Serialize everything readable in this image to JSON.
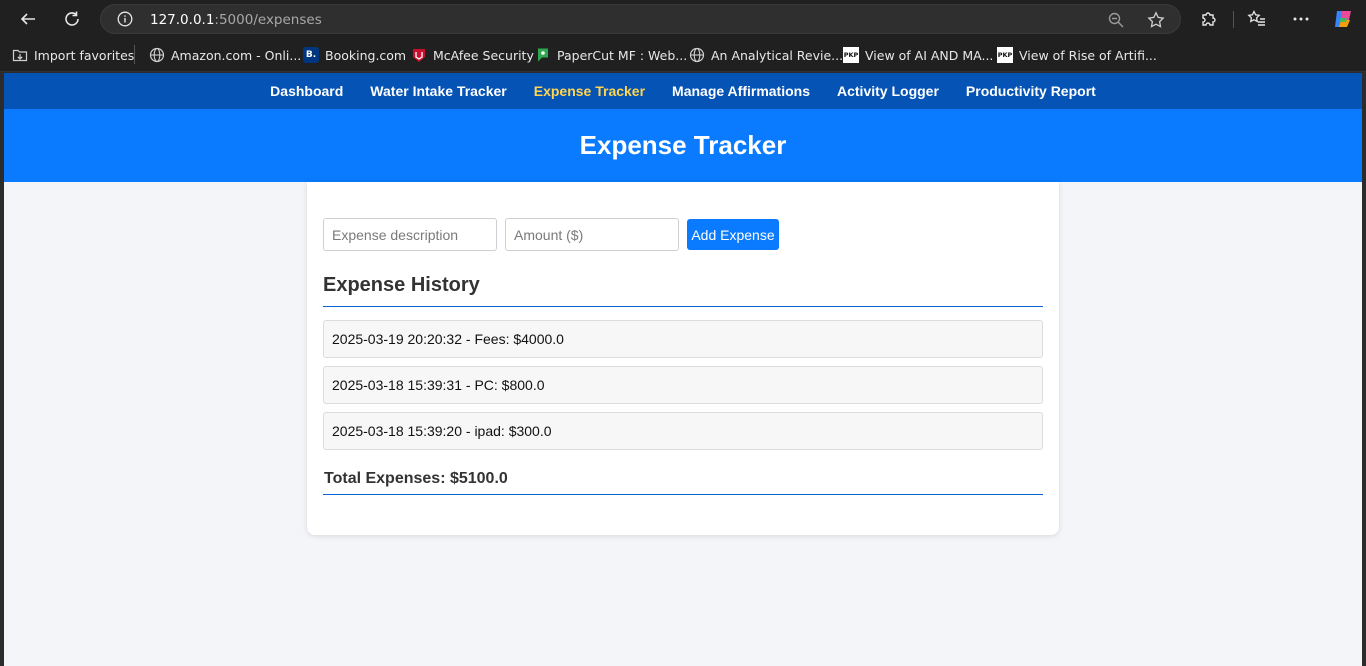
{
  "browser": {
    "url_host": "127.0.0.1",
    "url_rest": ":5000/expenses",
    "bookmarks": [
      {
        "label": "Import favorites",
        "icon": "folder-import-icon"
      },
      {
        "label": "Amazon.com - Onli...",
        "icon": "globe-icon"
      },
      {
        "label": "Booking.com",
        "icon": "booking-icon"
      },
      {
        "label": "McAfee Security",
        "icon": "mcafee-icon"
      },
      {
        "label": "PaperCut MF : Web...",
        "icon": "papercut-icon"
      },
      {
        "label": "An Analytical Revie...",
        "icon": "globe-icon"
      },
      {
        "label": "View of AI AND MA...",
        "icon": "pkp-icon"
      },
      {
        "label": "View of Rise of Artifi...",
        "icon": "pkp-icon"
      }
    ],
    "booking_glyph": "B.",
    "pkp_glyph": "PKP"
  },
  "nav": {
    "items": [
      "Dashboard",
      "Water Intake Tracker",
      "Expense Tracker",
      "Manage Affirmations",
      "Activity Logger",
      "Productivity Report"
    ],
    "active": "Expense Tracker",
    "active_color": "#ffd54f",
    "bg_color": "#0553b5"
  },
  "header": {
    "title": "Expense Tracker",
    "bg_color": "#0a7bfe"
  },
  "form": {
    "description_placeholder": "Expense description",
    "description_value": "",
    "amount_placeholder": "Amount ($)",
    "amount_value": "",
    "add_label": "Add Expense"
  },
  "history": {
    "title": "Expense History",
    "entries": [
      "2025-03-19 20:20:32 - Fees: $4000.0",
      "2025-03-18 15:39:31 - PC: $800.0",
      "2025-03-18 15:39:20 - ipad: $300.0"
    ],
    "total": "Total Expenses: $5100.0"
  }
}
